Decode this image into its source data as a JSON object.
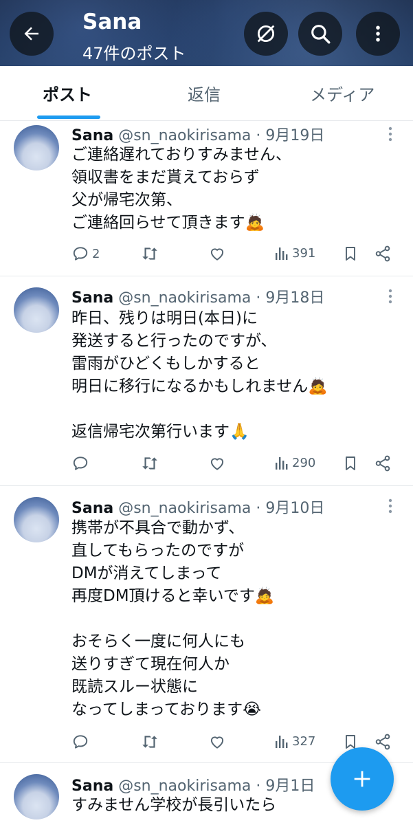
{
  "header": {
    "name": "Sana",
    "post_count": "47件のポスト",
    "icons": [
      "back-arrow-icon",
      "block-icon",
      "search-icon",
      "more-vertical-icon"
    ]
  },
  "tabs": [
    {
      "label": "ポスト",
      "active": true
    },
    {
      "label": "返信",
      "active": false
    },
    {
      "label": "メディア",
      "active": false
    }
  ],
  "tweets": [
    {
      "name": "Sana",
      "meta": "@sn_naokirisama · 9月19日",
      "lines": [
        "ご連絡遅れておりすみません、",
        "領収書をまだ貰えておらず",
        "父が帰宅次第、",
        "ご連絡回らせて頂きます🙇"
      ],
      "replies": "2",
      "views": "391"
    },
    {
      "name": "Sana",
      "meta": "@sn_naokirisama · 9月18日",
      "lines": [
        "昨日、残りは明日(本日)に",
        "発送すると行ったのですが、",
        "雷雨がひどくもしかすると",
        "明日に移行になるかもしれません🙇",
        "",
        "返信帰宅次第行います🙏"
      ],
      "replies": "",
      "views": "290"
    },
    {
      "name": "Sana",
      "meta": "@sn_naokirisama · 9月10日",
      "lines": [
        "携帯が不具合で動かず、",
        "直してもらったのですが",
        "DMが消えてしまって",
        "再度DM頂けると幸いです🙇",
        "",
        "おそらく一度に何人にも",
        "送りすぎて現在何人か",
        "既読スルー状態に",
        "なってしまっております😭"
      ],
      "replies": "",
      "views": "327"
    },
    {
      "name": "Sana",
      "meta": "@sn_naokirisama · 9月1日",
      "lines": [
        "すみません学校が長引いたら"
      ],
      "replies": "",
      "views": ""
    }
  ],
  "fab": {
    "icon": "plus-icon"
  },
  "colors": {
    "accent": "#1d9bf0",
    "text": "#0f1419",
    "muted": "#536471",
    "border": "#e6e9ec"
  }
}
